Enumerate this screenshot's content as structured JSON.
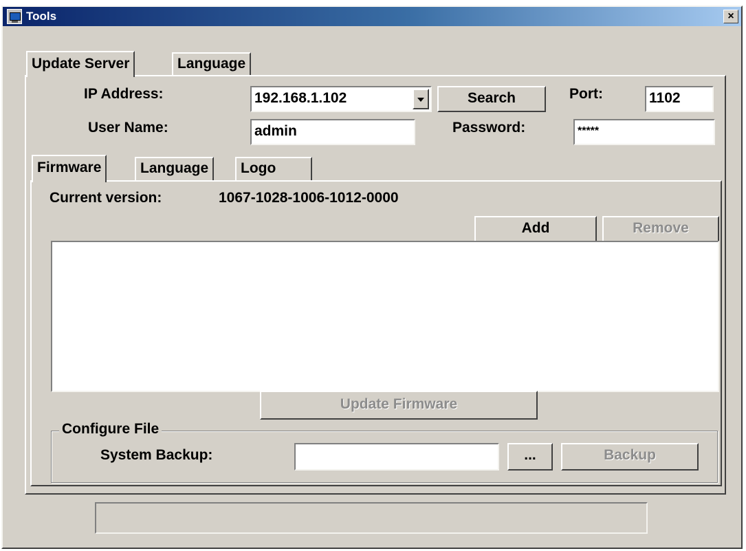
{
  "window": {
    "title": "Tools",
    "close_symbol": "×"
  },
  "top_tabs": [
    {
      "label": "Update Server",
      "active": true
    },
    {
      "label": "Language",
      "active": false
    }
  ],
  "server": {
    "ip_label": "IP Address:",
    "ip_value": "192.168.1.102",
    "search_label": "Search",
    "port_label": "Port:",
    "port_value": "1102",
    "user_label": "User Name:",
    "user_value": "admin",
    "password_label": "Password:",
    "password_value": "*****"
  },
  "sub_tabs": [
    {
      "label": "Firmware",
      "active": true
    },
    {
      "label": "Language",
      "active": false
    },
    {
      "label": "Logo",
      "active": false
    }
  ],
  "firmware": {
    "version_label": "Current version:",
    "version_value": "1067-1028-1006-1012-0000",
    "add_label": "Add",
    "remove_label": "Remove",
    "update_label": "Update Firmware"
  },
  "configure": {
    "group_label": "Configure File",
    "backup_label": "System Backup:",
    "browse_label": "...",
    "backup_button_label": "Backup"
  },
  "icons": {
    "app": "tools-window-icon",
    "close": "close-icon",
    "dropdown": "chevron-down-icon"
  }
}
